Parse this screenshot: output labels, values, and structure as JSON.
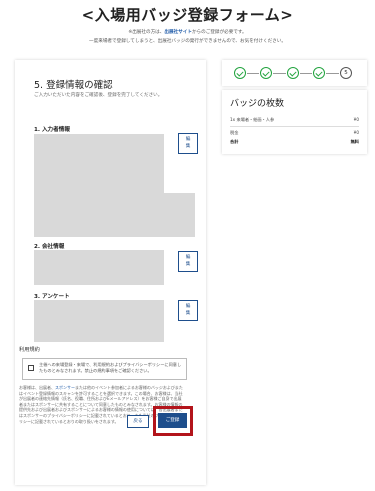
{
  "page": {
    "title": "<入場用バッジ登録フォーム>",
    "note1_prefix": "※出展社の方は、",
    "note1_link": "出展社サイト",
    "note1_suffix": "からのご登録が必要です。",
    "note2": "一度来場者で登録してしまうと、出展社バッジの発行ができませんので、お気を付けください。"
  },
  "confirm": {
    "title": "5. 登録情報の確認",
    "subtitle": "ご入力いただいた内容をご確認後、登録を完了してください。",
    "sections": [
      {
        "label": "1. 入力者情報",
        "edit": "編\n集"
      },
      {
        "label": "2. 会社情報",
        "edit": "編\n集"
      },
      {
        "label": "3. アンケート",
        "edit": "編\n集"
      }
    ],
    "terms_title": "利用規約",
    "terms_text": "主催への来場登録・来場で、利用規約およびプライバシーポリシーに同意したものとみなされます。禁止の規約事項をご確認ください。",
    "fine_print_1": "お客様は、出展者、",
    "fine_print_link": "スポンサー",
    "fine_print_2": "または他のイベント参加者によるお客様のバッジおよびまたはイベント登録情報のスキャンを許可することを選択できます。この場合、お客様は、当社が出展者の連絡先情報（氏名、役職、住所およびEメールアドレス）をお客様ご自身で出展者またはスポンサーに共有することについて同意したものとみなされます。お客様の情報の提供先および出展者およびスポンサーによるお客様の情報の使用については、各出展者またはスポンサーのプライバシーポリシーに記載されているとおり、また当社のプライバシーポリシーに記載されているとおりの取り扱いをされます。",
    "back_label": "戻る",
    "submit_label": "ご登録"
  },
  "steps": {
    "current_number": "5",
    "done_color": "#22a33e"
  },
  "badges": {
    "title": "バッジの枚数",
    "rows": [
      {
        "label": "1x 来場者・絵画・人参",
        "value": "¥0"
      },
      {
        "label": "税金",
        "value": "¥0"
      },
      {
        "label": "合計",
        "value": "無料"
      }
    ]
  },
  "colors": {
    "accent": "#1e4e8c",
    "highlight": "#b3141b",
    "placeholder_gray": "#d9d9d9"
  }
}
